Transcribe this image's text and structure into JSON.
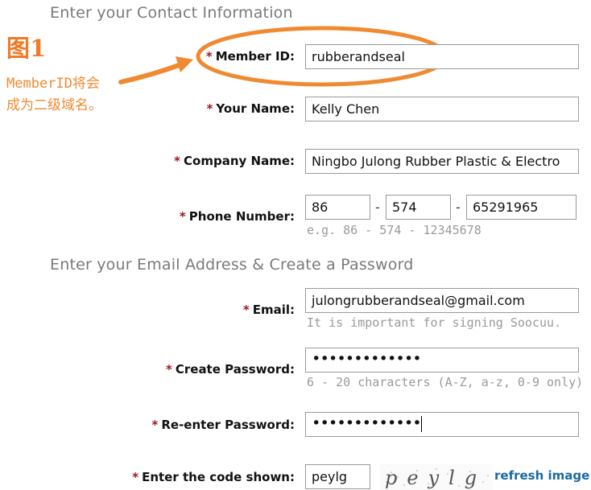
{
  "section1": {
    "title": "Enter your Contact Information"
  },
  "section2": {
    "title": "Enter your Email Address & Create a Password"
  },
  "required_mark": "*",
  "annotation": {
    "figure_label": "图1",
    "note_line1": "MemberID将会",
    "note_line2": "成为二级域名。",
    "accent_color": "#f07a26"
  },
  "fields": {
    "member_id": {
      "label": "Member ID:",
      "value": "rubberandseal"
    },
    "your_name": {
      "label": "Your Name:",
      "value": "Kelly Chen"
    },
    "company_name": {
      "label": "Company Name:",
      "value": "Ningbo Julong Rubber Plastic & Electro"
    },
    "phone": {
      "label": "Phone Number:",
      "country": "86",
      "area": "574",
      "number": "65291965",
      "separator": "-",
      "hint": "e.g. 86 - 574 - 12345678"
    },
    "email": {
      "label": "Email:",
      "value": "julongrubberandseal@gmail.com",
      "hint": "It is important for signing Soocuu."
    },
    "create_password": {
      "label": "Create Password:",
      "masked_value": "•••••••••••••",
      "hint": "6 - 20 characters (A-Z, a-z, 0-9 only)"
    },
    "reenter_password": {
      "label": "Re-enter Password:",
      "masked_value": "•••••••••••••"
    },
    "captcha": {
      "label": "Enter the code shown:",
      "value": "peylg",
      "image_text": "peylg",
      "refresh_label": "refresh image"
    }
  },
  "colors": {
    "required_star": "#a01818",
    "section_title": "#7a7a7a",
    "hint": "#9a9a9a",
    "link": "#1a6aa0"
  }
}
